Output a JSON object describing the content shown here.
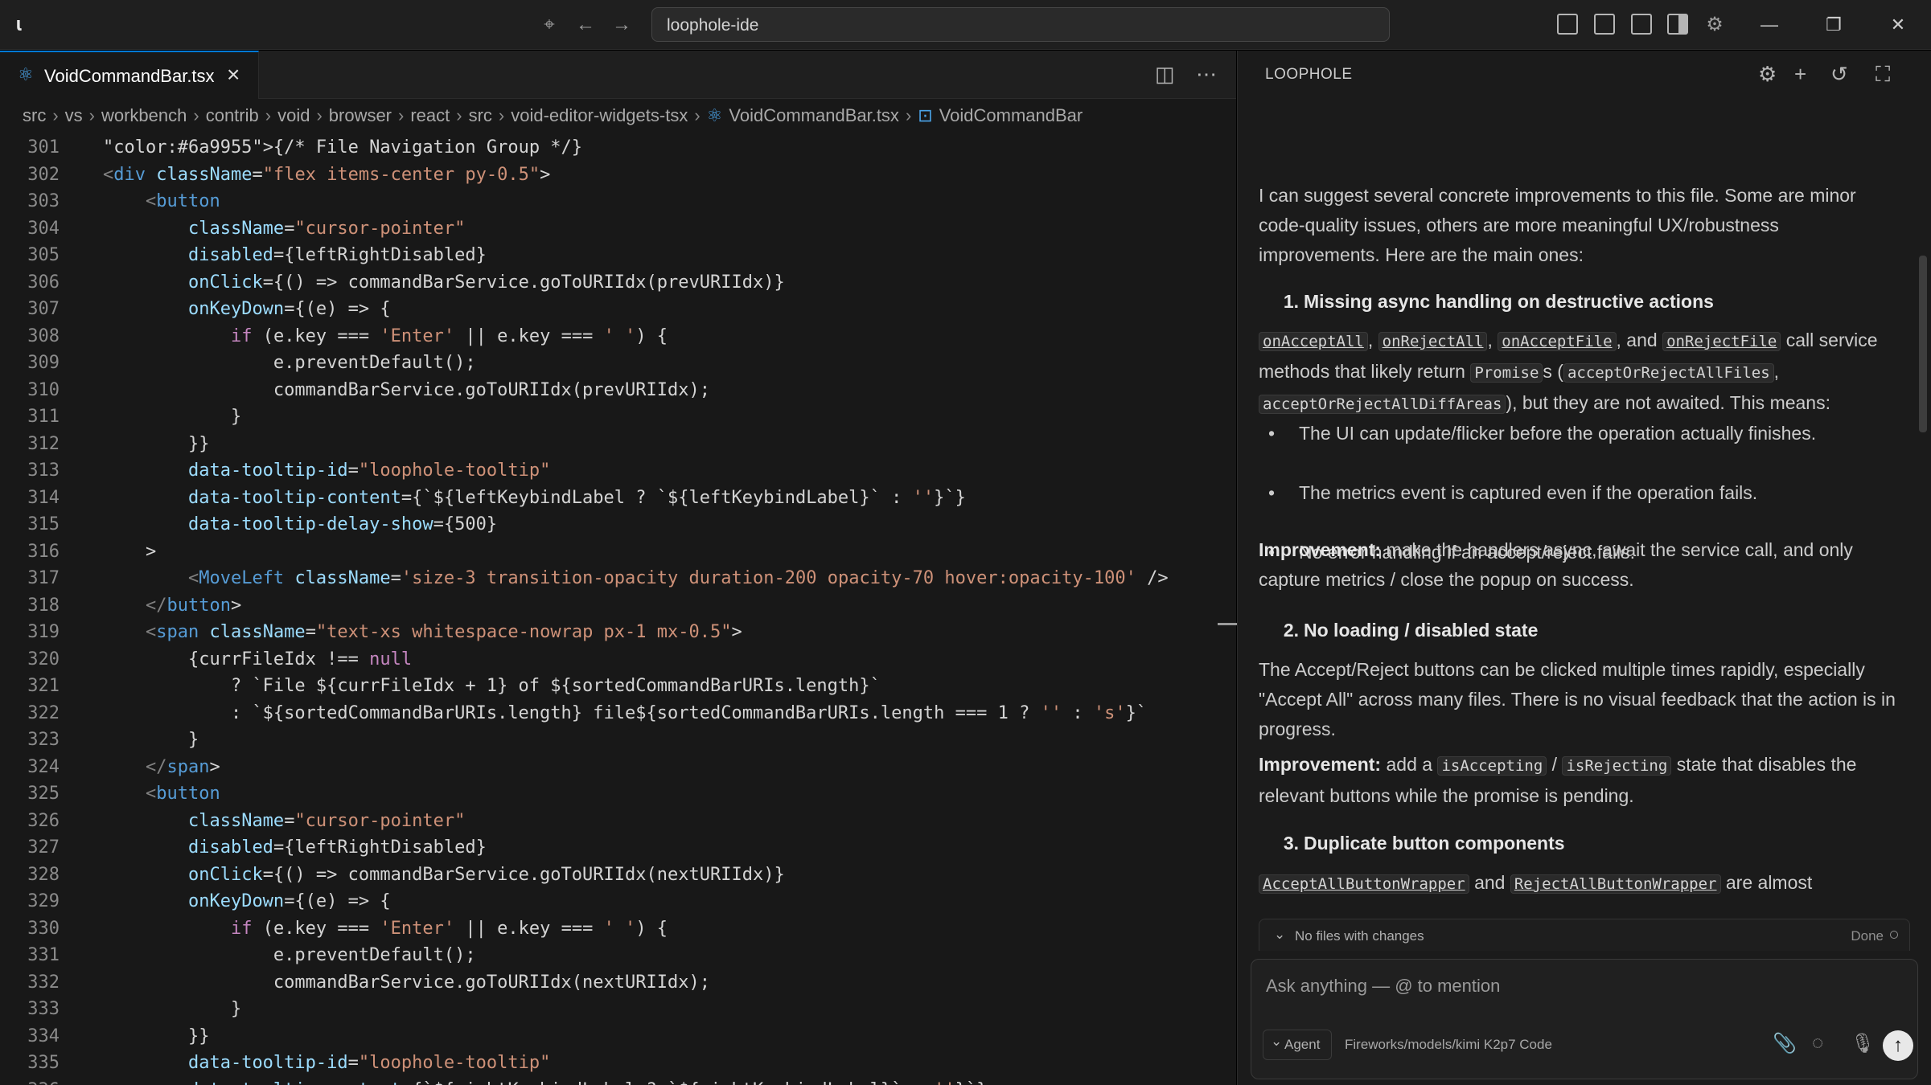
{
  "titlebar": {
    "search_text": "loophole-ide"
  },
  "editor": {
    "tab_label": "VoidCommandBar.tsx",
    "breadcrumb": [
      "src",
      "vs",
      "workbench",
      "contrib",
      "void",
      "browser",
      "react",
      "src",
      "void-editor-widgets-tsx",
      "VoidCommandBar.tsx",
      "VoidCommandBar"
    ],
    "lines": [
      {
        "n": "301",
        "t": "{/* File Navigation Group */}"
      },
      {
        "n": "302",
        "t": "<div className=\"flex items-center py-0.5\">"
      },
      {
        "n": "303",
        "t": "    <button"
      },
      {
        "n": "304",
        "t": "        className=\"cursor-pointer\""
      },
      {
        "n": "305",
        "t": "        disabled={leftRightDisabled}"
      },
      {
        "n": "306",
        "t": "        onClick={() => commandBarService.goToURIIdx(prevURIIdx)}"
      },
      {
        "n": "307",
        "t": "        onKeyDown={(e) => {"
      },
      {
        "n": "308",
        "t": "            if (e.key === 'Enter' || e.key === ' ') {"
      },
      {
        "n": "309",
        "t": "                e.preventDefault();"
      },
      {
        "n": "310",
        "t": "                commandBarService.goToURIIdx(prevURIIdx);"
      },
      {
        "n": "311",
        "t": "            }"
      },
      {
        "n": "312",
        "t": "        }}"
      },
      {
        "n": "313",
        "t": "        data-tooltip-id=\"loophole-tooltip\""
      },
      {
        "n": "314",
        "t": "        data-tooltip-content={`${leftKeybindLabel ? `${leftKeybindLabel}` : ''}`}"
      },
      {
        "n": "315",
        "t": "        data-tooltip-delay-show={500}"
      },
      {
        "n": "316",
        "t": "    >"
      },
      {
        "n": "317",
        "t": "        <MoveLeft className='size-3 transition-opacity duration-200 opacity-70 hover:opacity-100' />"
      },
      {
        "n": "318",
        "t": "    </button>"
      },
      {
        "n": "319",
        "t": "    <span className=\"text-xs whitespace-nowrap px-1 mx-0.5\">"
      },
      {
        "n": "320",
        "t": "        {currFileIdx !== null"
      },
      {
        "n": "321",
        "t": "            ? `File ${currFileIdx + 1} of ${sortedCommandBarURIs.length}`"
      },
      {
        "n": "322",
        "t": "            : `${sortedCommandBarURIs.length} file${sortedCommandBarURIs.length === 1 ? '' : 's'}`"
      },
      {
        "n": "323",
        "t": "        }"
      },
      {
        "n": "324",
        "t": "    </span>"
      },
      {
        "n": "325",
        "t": "    <button"
      },
      {
        "n": "326",
        "t": "        className=\"cursor-pointer\""
      },
      {
        "n": "327",
        "t": "        disabled={leftRightDisabled}"
      },
      {
        "n": "328",
        "t": "        onClick={() => commandBarService.goToURIIdx(nextURIIdx)}"
      },
      {
        "n": "329",
        "t": "        onKeyDown={(e) => {"
      },
      {
        "n": "330",
        "t": "            if (e.key === 'Enter' || e.key === ' ') {"
      },
      {
        "n": "331",
        "t": "                e.preventDefault();"
      },
      {
        "n": "332",
        "t": "                commandBarService.goToURIIdx(nextURIIdx);"
      },
      {
        "n": "333",
        "t": "            }"
      },
      {
        "n": "334",
        "t": "        }}"
      },
      {
        "n": "335",
        "t": "        data-tooltip-id=\"loophole-tooltip\""
      },
      {
        "n": "336",
        "t": "        data-tooltip-content={`${rightKeybindLabel ? `${rightKeybindLabel}` : ''}`}"
      }
    ]
  },
  "chat": {
    "title": "LOOPHOLE",
    "intro": "I can suggest several concrete improvements to this file. Some are minor code-quality issues, others are more meaningful UX/robustness improvements. Here are the main ones:",
    "s1": {
      "num": "1.",
      "heading": "Missing async handling on destructive actions",
      "code1": "onAcceptAll",
      "code2": "onRejectAll",
      "code3": "onAcceptFile",
      "code4": "onRejectFile",
      "and": ", and",
      "t1": "call service methods that likely return",
      "code5": "Promise",
      "t2": "s (",
      "code6": "acceptOrRejectAllFiles",
      "code7": "acceptOrRejectAllDiffAreas",
      "t3": "), but they are not awaited. This means:",
      "b1": "The UI can update/flicker before the operation actually finishes.",
      "b2": "The metrics event is captured even if the operation fails.",
      "b3": "No error handling if an accept/reject fails.",
      "imp_label": "Improvement:",
      "imp_text": "make the handlers async, await the service call, and only capture metrics / close the popup on success."
    },
    "s2": {
      "num": "2.",
      "heading": "No loading / disabled state",
      "text": "The Accept/Reject buttons can be clicked multiple times rapidly, especially \"Accept All\" across many files. There is no visual feedback that the action is in progress.",
      "imp_label": "Improvement:",
      "imp_t1": "add a",
      "code1": "isAccepting",
      "slash": "/",
      "code2": "isRejecting",
      "imp_t2": "state that disables the relevant buttons while the promise is pending."
    },
    "s3": {
      "num": "3.",
      "heading": "Duplicate button components",
      "code1": "AcceptAllButtonWrapper",
      "and": "and",
      "code2": "RejectAllButtonWrapper",
      "t1": "are almost"
    },
    "changes": {
      "label": "No files with changes",
      "done": "Done"
    },
    "composer": {
      "placeholder": "Ask anything — @ to mention",
      "agent": "Agent",
      "model": "Fireworks/models/kimi K2p7 Code"
    }
  },
  "colors": {
    "keyword": "#569cd6",
    "tag": "#569cd6",
    "attr": "#9cdcfe",
    "string": "#ce9178",
    "comment": "#6a9955",
    "accent": "#0078d4"
  }
}
